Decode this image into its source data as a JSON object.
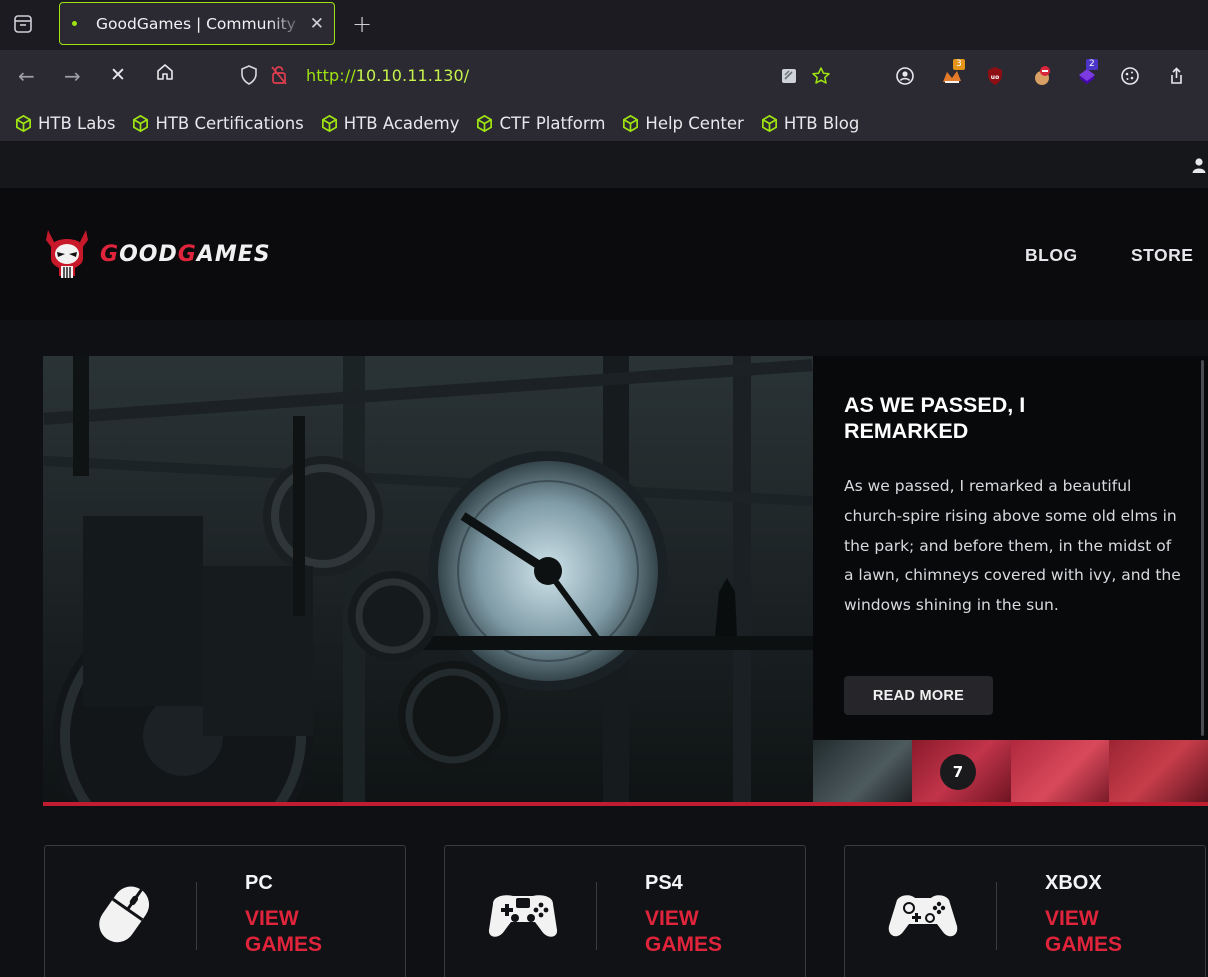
{
  "browser": {
    "tab": {
      "title": "GoodGames | Community"
    },
    "url": {
      "scheme": "http://",
      "host": "10.10.11.130/"
    },
    "extensions": [
      {
        "name": "foxyproxy-icon",
        "badge": "3"
      },
      {
        "name": "ublock-icon",
        "badge": ""
      },
      {
        "name": "cookie-editor-icon",
        "badge": ""
      },
      {
        "name": "wappalyzer-icon",
        "badge": "2"
      }
    ],
    "bookmarks": [
      {
        "label": "HTB Labs"
      },
      {
        "label": "HTB Certifications"
      },
      {
        "label": "HTB Academy"
      },
      {
        "label": "CTF Platform"
      },
      {
        "label": "Help Center"
      },
      {
        "label": "HTB Blog"
      }
    ]
  },
  "site": {
    "logo": {
      "prefix": "G",
      "rest1": "OOD",
      "prefix2": "G",
      "rest2": "AMES"
    },
    "menu": {
      "blog": "BLOG",
      "store": "STORE"
    },
    "hero": {
      "title": "AS WE PASSED, I REMARKED",
      "text": "As we passed, I remarked a beautiful church-spire rising above some old elms in the park; and before them, in the midst of a lawn, chimneys covered with ivy, and the windows shining in the sun.",
      "button": "READ MORE",
      "thumb_count": "7"
    },
    "platforms": [
      {
        "name": "PC",
        "link": "VIEW GAMES",
        "icon": "mouse-icon"
      },
      {
        "name": "PS4",
        "link": "VIEW GAMES",
        "icon": "ps4-controller-icon"
      },
      {
        "name": "XBOX",
        "link": "VIEW GAMES",
        "icon": "xbox-controller-icon"
      }
    ]
  },
  "colors": {
    "accent_red": "#e0243b",
    "browser_accent": "#a0e312",
    "header_bg": "#0b0b0d"
  }
}
